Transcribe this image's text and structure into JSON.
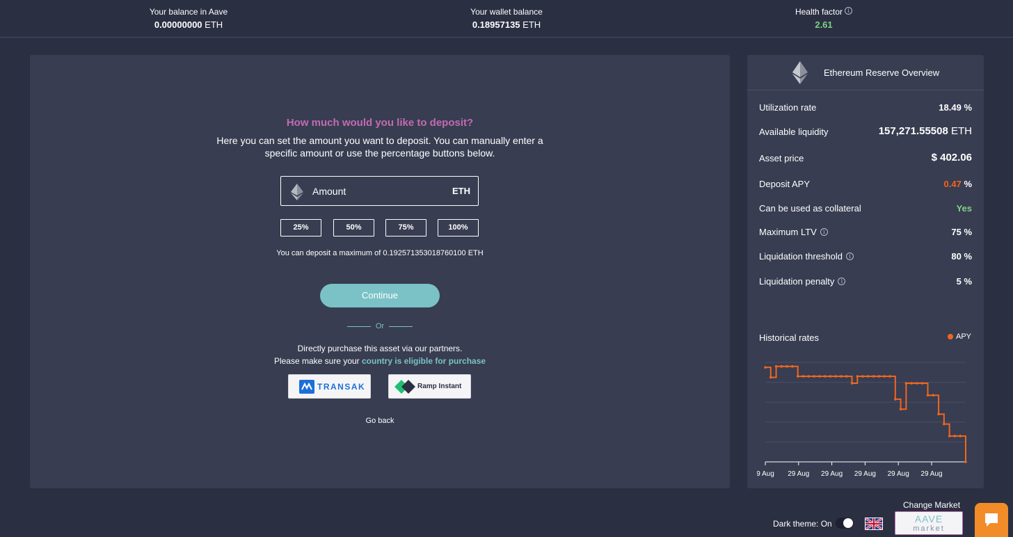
{
  "topbar": {
    "balance_label": "Your balance in Aave",
    "balance_value": "0.00000000",
    "balance_unit": "ETH",
    "wallet_label": "Your wallet balance",
    "wallet_value": "0.18957135",
    "wallet_unit": "ETH",
    "health_label": "Health factor",
    "health_value": "2.61"
  },
  "deposit": {
    "question": "How much would you like to deposit?",
    "description": "Here you can set the amount you want to deposit. You can manually enter a specific amount or use the percentage buttons below.",
    "amount_placeholder": "Amount",
    "amount_unit": "ETH",
    "percent_buttons": [
      "25%",
      "50%",
      "75%",
      "100%"
    ],
    "max_text": "You can deposit a maximum of 0.192571353018760100 ETH",
    "continue_label": "Continue",
    "or_label": "Or",
    "partners_line1": "Directly purchase this asset via our partners.",
    "partners_line2_prefix": "Please make sure your ",
    "partners_line2_link": "country is eligible for purchase",
    "transak_label": "TRANSAK",
    "ramp_label": "Ramp Instant",
    "go_back_label": "Go back"
  },
  "reserve": {
    "title": "Ethereum Reserve Overview",
    "rows": [
      {
        "label": "Utilization rate",
        "value": "18.49",
        "unit": "%"
      },
      {
        "label": "Available liquidity",
        "value": "157,271.55508",
        "unit": "ETH"
      },
      {
        "label": "Asset price",
        "value": "$ 402.06",
        "unit": ""
      },
      {
        "label": "Deposit APY",
        "value": "0.47",
        "unit": "%"
      },
      {
        "label": "Can be used as collateral",
        "value": "Yes",
        "unit": ""
      },
      {
        "label": "Maximum LTV",
        "value": "75",
        "unit": "%"
      },
      {
        "label": "Liquidation threshold",
        "value": "80",
        "unit": "%"
      },
      {
        "label": "Liquidation penalty",
        "value": "5",
        "unit": "%"
      }
    ],
    "historical_label": "Historical rates",
    "legend_label": "APY",
    "x_labels": [
      "9 Aug",
      "29 Aug",
      "29 Aug",
      "29 Aug",
      "29 Aug",
      "29 Aug"
    ]
  },
  "chart_data": {
    "type": "line",
    "x": [
      "9 Aug",
      "29 Aug",
      "29 Aug",
      "29 Aug",
      "29 Aug",
      "29 Aug"
    ],
    "series": [
      {
        "name": "APY",
        "values": [
          0.95,
          0.85,
          0.96,
          0.96,
          0.96,
          0.96,
          0.86,
          0.86,
          0.86,
          0.86,
          0.86,
          0.86,
          0.86,
          0.86,
          0.86,
          0.86,
          0.79,
          0.86,
          0.86,
          0.86,
          0.86,
          0.86,
          0.86,
          0.86,
          0.63,
          0.53,
          0.79,
          0.79,
          0.79,
          0.79,
          0.67,
          0.67,
          0.48,
          0.38,
          0.26,
          0.26,
          0.26,
          0.0
        ]
      }
    ],
    "colors": {
      "APY": "#f0661e"
    },
    "grid": true,
    "legend": "top-right"
  },
  "footer": {
    "dark_theme_label": "Dark theme: On",
    "change_market_label": "Change Market",
    "market_brand": "AAVE",
    "market_sub": "market"
  },
  "icons": [
    "ethereum-icon",
    "info-icon",
    "uk-flag-icon",
    "chat-icon"
  ]
}
